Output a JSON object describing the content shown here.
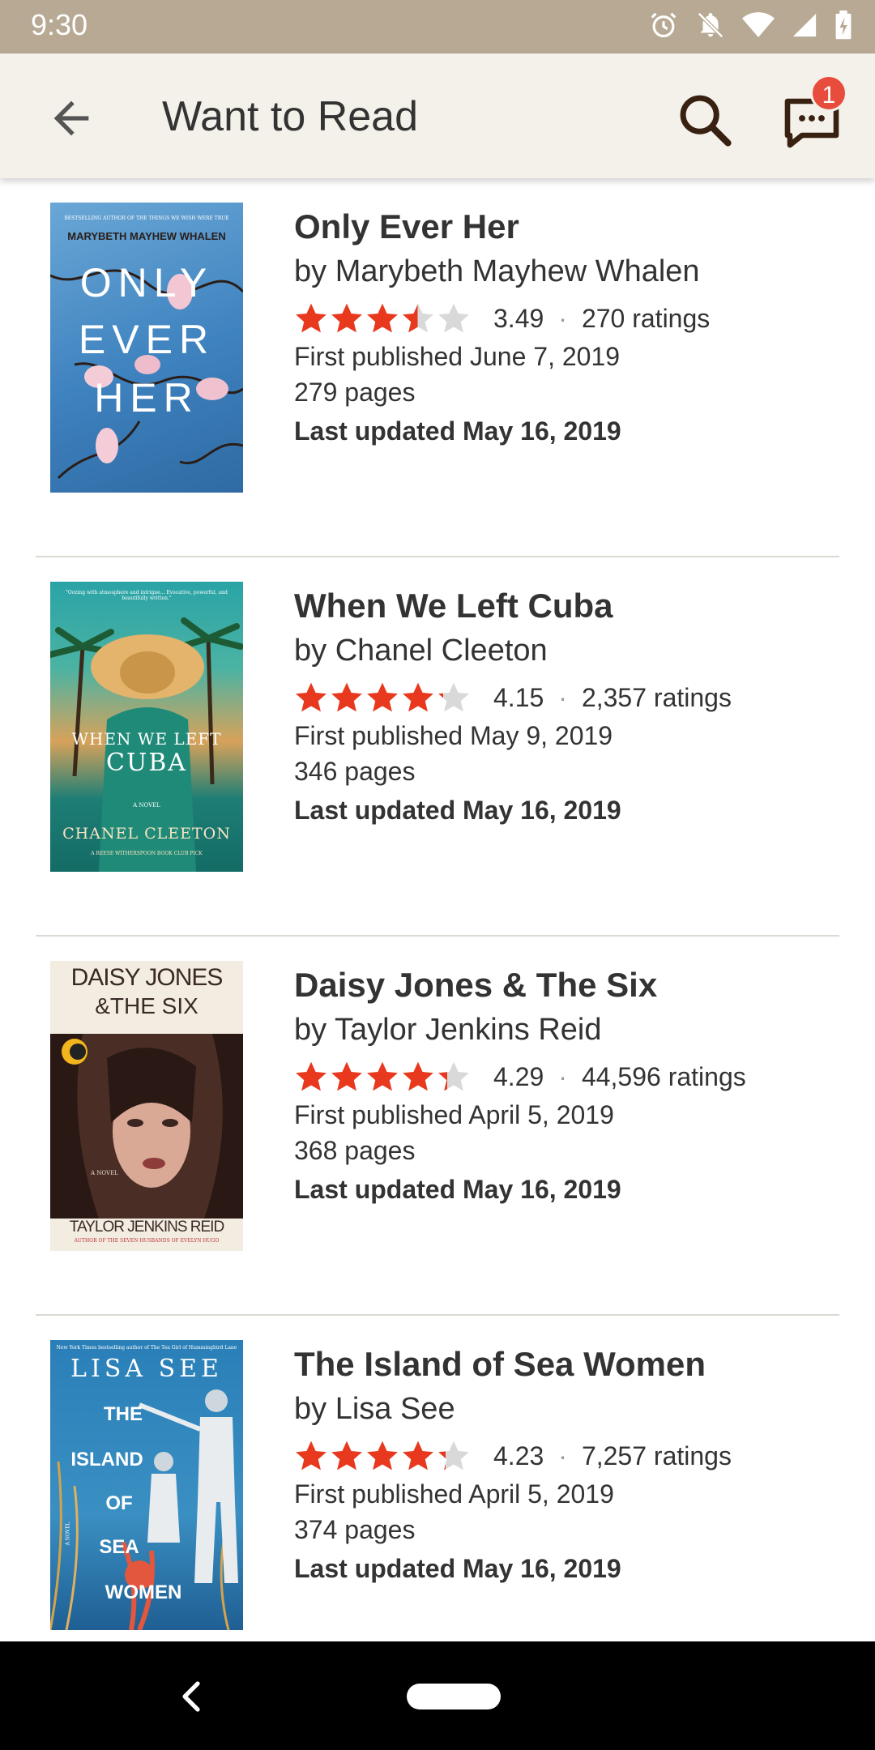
{
  "status_bar": {
    "time": "9:30",
    "icons": [
      "alarm-icon",
      "notifications-off-icon",
      "wifi-icon",
      "cell-signal-icon",
      "battery-charging-icon"
    ]
  },
  "app_bar": {
    "title": "Want to Read",
    "back_icon": "arrow-back-icon",
    "search_icon": "search-icon",
    "messages_icon": "chat-icon",
    "messages_badge": "1"
  },
  "colors": {
    "status_bar_bg": "#b7a994",
    "app_bar_bg": "#f4f1ea",
    "star_filled": "#e8391e",
    "star_empty": "#d9d9d9",
    "badge": "#e74c3c"
  },
  "books": [
    {
      "title": "Only Ever Her",
      "author": "by Marybeth Mayhew Whalen",
      "rating": "3.49",
      "rating_value": 3.49,
      "ratings_count": "270 ratings",
      "first_published": "First published June 7, 2019",
      "pages": "279 pages",
      "last_updated": "Last updated May 16, 2019",
      "cover": {
        "top_text": "BESTSELLING AUTHOR OF THE THINGS WE WISH WERE TRUE",
        "author_text": "MARYBETH MAYHEW WHALEN",
        "title_lines": [
          "ONLY",
          "EVER",
          "HER"
        ]
      }
    },
    {
      "title": "When We Left Cuba",
      "author": "by Chanel Cleeton",
      "rating": "4.15",
      "rating_value": 4.15,
      "ratings_count": "2,357 ratings",
      "first_published": "First published May 9, 2019",
      "pages": "346 pages",
      "last_updated": "Last updated May 16, 2019",
      "cover": {
        "top_text": "\"Oozing with atmosphere and intrigue... Evocative, powerful, and beautifully written.\"",
        "title_lines": [
          "WHEN WE LEFT",
          "CUBA"
        ],
        "novel_text": "A NOVEL",
        "author_text": "CHANEL CLEETON",
        "bottom_text": "A REESE WITHERSPOON BOOK CLUB PICK"
      }
    },
    {
      "title": "Daisy Jones & The Six",
      "author": "by Taylor Jenkins Reid",
      "rating": "4.29",
      "rating_value": 4.29,
      "ratings_count": "44,596 ratings",
      "first_published": "First published April 5, 2019",
      "pages": "368 pages",
      "last_updated": "Last updated May 16, 2019",
      "cover": {
        "title_lines": [
          "DAISY JONES",
          "&THE SIX"
        ],
        "novel_text": "A NOVEL",
        "author_text": "TAYLOR JENKINS REID",
        "bottom_text": "AUTHOR OF THE SEVEN HUSBANDS OF EVELYN HUGO"
      }
    },
    {
      "title": "The Island of Sea Women",
      "author": "by Lisa See",
      "rating": "4.23",
      "rating_value": 4.23,
      "ratings_count": "7,257 ratings",
      "first_published": "First published April 5, 2019",
      "pages": "374 pages",
      "last_updated": "Last updated May 16, 2019",
      "cover": {
        "top_text": "New York Times bestselling author of The Tea Girl of Hummingbird Lane",
        "author_text": "LISA SEE",
        "title_lines": [
          "THE",
          "ISLAND",
          "OF",
          "SEA",
          "WOMEN"
        ],
        "novel_text": "A NOVEL"
      }
    }
  ],
  "nav_bar": {
    "back_icon": "nav-back-icon",
    "home_icon": "home-pill-icon"
  }
}
